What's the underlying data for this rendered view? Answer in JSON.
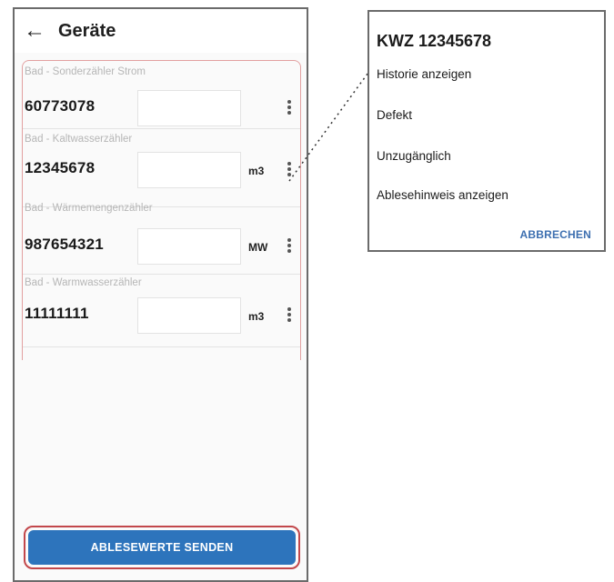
{
  "app": {
    "title": "Geräte",
    "back_icon": "arrow-left-icon"
  },
  "devices": [
    {
      "label": "Bad - Sonderzähler Strom",
      "number": "60773078",
      "unit": "",
      "reading": ""
    },
    {
      "label": "Bad - Kaltwasserzähler",
      "number": "12345678",
      "unit": "m3",
      "reading": ""
    },
    {
      "label": "Bad - Wärmemengenzähler",
      "number": "987654321",
      "unit": "MW",
      "reading": ""
    },
    {
      "label": "Bad - Warmwasserzähler",
      "number": "11111111",
      "unit": "m3",
      "reading": ""
    }
  ],
  "send_button": {
    "label": "ABLESEWERTE SENDEN",
    "color": "#2d74bc",
    "highlight": "#c2474b"
  },
  "dialog": {
    "title": "KWZ 12345678",
    "items": [
      "Historie anzeigen",
      "Defekt",
      "Unzugänglich",
      "Ablesehinweis anzeigen"
    ],
    "cancel_label": "ABBRECHEN"
  }
}
